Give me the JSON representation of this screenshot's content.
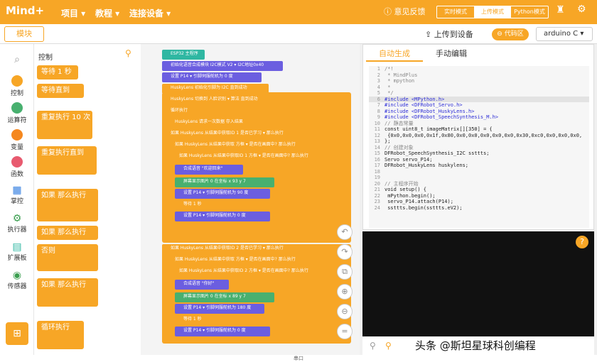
{
  "app": {
    "logo": "Mind+",
    "menus": [
      "项目 ▾",
      "教程 ▾",
      "连接设备 ▾"
    ],
    "feedback": "意见反馈",
    "modes": [
      "实时模式",
      "上传模式",
      "Python模式"
    ],
    "active_mode": "上传模式"
  },
  "toolbar": {
    "module_tab": "模块",
    "upload": "上传到设备",
    "code_zone": "代码区",
    "board": "arduino C"
  },
  "categories": [
    {
      "label": "控制",
      "color": "#f7a626"
    },
    {
      "label": "运算符",
      "color": "#48b06f"
    },
    {
      "label": "变量",
      "color": "#f5881f"
    },
    {
      "label": "函数",
      "color": "#e85a6f"
    },
    {
      "label": "掌控",
      "color": "#2d7be0"
    },
    {
      "label": "执行器",
      "color": "#3a9e4f"
    },
    {
      "label": "扩展板",
      "color": "#2fb7a2"
    },
    {
      "label": "传感器",
      "color": "#3a9e4f"
    }
  ],
  "palette": {
    "title": "控制",
    "blocks": [
      "等待 1 秒",
      "等待直到",
      "重复执行 10 次",
      "重复执行直到",
      "如果 那么执行",
      "如果 那么执行",
      "否则",
      "如果 那么执行",
      "循环执行"
    ]
  },
  "workspace": [
    {
      "text": "ESP32 主程序",
      "c": "k"
    },
    {
      "text": "初始化语音合成模块 I2C模式 V2 ▾ I2C地址0x40",
      "c": "b"
    },
    {
      "text": "设置 P14 ▾ 引脚伺服舵机为 0 度",
      "c": "b"
    },
    {
      "text": "HuskyLens 初始化引脚为 I2C 直到成功",
      "c": "o"
    },
    {
      "text": "HuskyLens 切换到 人脸识别 ▾ 算法 直到成功",
      "c": "o"
    },
    {
      "text": "循环执行",
      "c": "o"
    },
    {
      "text": "HuskyLens 请求一次数据 存入结果",
      "c": "o"
    },
    {
      "text": "如果 HuskyLens 从结果中获取ID 1 是否已学习 ▾ 那么执行",
      "c": "o"
    },
    {
      "text": "如果 HuskyLens 从结果中获取 方框 ▾ 是否在画面中? 那么执行",
      "c": "o"
    },
    {
      "text": "如果 HuskyLens 从结果中获取ID 1 方框 ▾ 是否在画面中? 那么执行",
      "c": "o"
    },
    {
      "text": "合成语音 \"欢迎回来\"",
      "c": "b"
    },
    {
      "text": "屏幕显示图片 0 在坐标 x 93 y 7",
      "c": "g"
    },
    {
      "text": "设置 P14 ▾ 引脚伺服舵机为 90 度",
      "c": "b"
    },
    {
      "text": "等待 1 秒",
      "c": "o"
    },
    {
      "text": "设置 P14 ▾ 引脚伺服舵机为 0 度",
      "c": "b"
    },
    {
      "text": "如果 HuskyLens 从结果中获取ID 2 是否已学习 ▾ 那么执行",
      "c": "o"
    },
    {
      "text": "如果 HuskyLens 从结果中获取 方框 ▾ 是否在画面中? 那么执行",
      "c": "o"
    },
    {
      "text": "如果 HuskyLens 从结果中获取ID 2 方框 ▾ 是否在画面中? 那么执行",
      "c": "o"
    },
    {
      "text": "合成语音 \"你好\"",
      "c": "b"
    },
    {
      "text": "屏幕显示图片 0 在坐标 x 89 y 7",
      "c": "g"
    },
    {
      "text": "设置 P14 ▾ 引脚伺服舵机为 180 度",
      "c": "b"
    },
    {
      "text": "等待 1 秒",
      "c": "o"
    },
    {
      "text": "设置 P14 ▾ 引脚伺服舵机为 0 度",
      "c": "b"
    }
  ],
  "code_tabs": [
    "自动生成",
    "手动编辑"
  ],
  "code": [
    [
      "1",
      "/*!"
    ],
    [
      "2",
      " * MindPlus"
    ],
    [
      "3",
      " * mpython"
    ],
    [
      "4",
      " *"
    ],
    [
      "5",
      " */"
    ],
    [
      "6",
      "#include <MPython.h>"
    ],
    [
      "7",
      "#include <DFRobot_Servo.h>"
    ],
    [
      "8",
      "#include <DFRobot_HuskyLens.h>"
    ],
    [
      "9",
      "#include <DFRobot_SpeechSynthesis_M.h>"
    ],
    [
      "10",
      "// 静态常量"
    ],
    [
      "11",
      "const uint8_t imageMatrix[][350] = {"
    ],
    [
      "12",
      "  {0x0,0x0,0x0,0x1f,0x80,0x0,0x0,0x0,0x0,0x0,0x30,0xc0,0x0,0x0,0x0,"
    ],
    [
      "13",
      "};"
    ],
    [
      "14",
      "// 创建对象"
    ],
    [
      "15",
      "DFRobot_SpeechSynthesis_I2C  ssttts;"
    ],
    [
      "16",
      "Servo                       servo_P14;"
    ],
    [
      "17",
      "DFRobot_HuskyLens           huskylens;"
    ],
    [
      "18",
      ""
    ],
    [
      "19",
      ""
    ],
    [
      "20",
      "// 主程序开始"
    ],
    [
      "21",
      "void setup() {"
    ],
    [
      "22",
      "  mPython.begin();"
    ],
    [
      "23",
      "  servo_P14.attach(P14);"
    ],
    [
      "24",
      "  ssttts.begin(ssttts.eV2);"
    ]
  ],
  "status": "串口",
  "watermark": "头条 @斯坦星球科创编程"
}
